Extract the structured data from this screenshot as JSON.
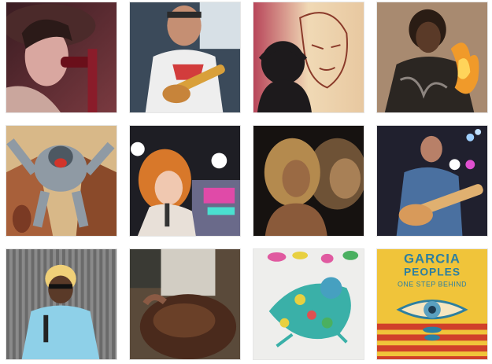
{
  "album_art": {
    "title": "GARCIA",
    "subtitle_line": "PEOPLES",
    "tagline": "ONE STEP BEHIND"
  }
}
